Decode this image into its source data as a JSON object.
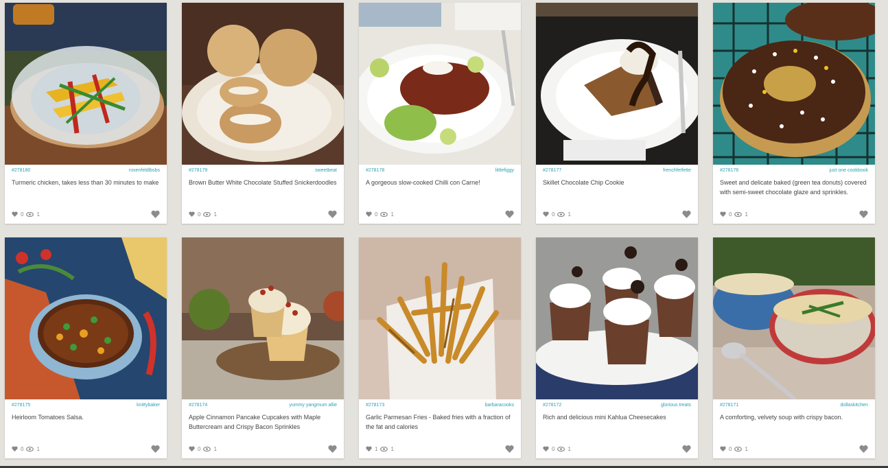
{
  "colors": {
    "background": "#e3e2dd",
    "link": "#2b9fb5",
    "text": "#444444",
    "icon": "#888888"
  },
  "cards": [
    {
      "id": "#278180",
      "user": "rosenfeldlbsbs",
      "desc": "Turmeric chicken, takes less than 30 minutes to make",
      "likes": "0",
      "views": "1",
      "photo": "turmeric-chicken"
    },
    {
      "id": "#278179",
      "user": "sweetbeat",
      "desc": "Brown Butter White Chocolate Stuffed Snickerdoodles",
      "likes": "0",
      "views": "1",
      "photo": "snickerdoodles"
    },
    {
      "id": "#278178",
      "user": "littlefiggy",
      "desc": "A gorgeous slow-cooked Chilli con Carne!",
      "likes": "0",
      "views": "1",
      "photo": "chilli"
    },
    {
      "id": "#278177",
      "user": "frenchfetfette",
      "desc": "Skillet Chocolate Chip Cookie",
      "likes": "0",
      "views": "1",
      "photo": "skillet-cookie"
    },
    {
      "id": "#278176",
      "user": "just one cookbook",
      "desc": "Sweet and delicate baked (green tea donuts) covered with semi-sweet chocolate glaze and sprinkles.",
      "likes": "0",
      "views": "1",
      "photo": "donut"
    },
    {
      "id": "#278175",
      "user": "knittybaker",
      "desc": "Heirloom Tomatoes Salsa.",
      "likes": "0",
      "views": "1",
      "photo": "salsa"
    },
    {
      "id": "#278174",
      "user": "yummy yangmum allie",
      "desc": "Apple Cinnamon Pancake Cupcakes with Maple Buttercream and Crispy Bacon Sprinkles",
      "likes": "0",
      "views": "1",
      "photo": "cupcakes"
    },
    {
      "id": "#278173",
      "user": "barbaracooks",
      "desc": "Garlic Parmesan Fries - Baked fries with a fraction of the fat and calories",
      "likes": "1",
      "views": "1",
      "photo": "fries"
    },
    {
      "id": "#278172",
      "user": "glorious treats",
      "desc": "Rich and delicious mini Kahlua Cheesecakes",
      "likes": "0",
      "views": "1",
      "photo": "cheesecakes"
    },
    {
      "id": "#278171",
      "user": "dollaskitchen",
      "desc": "A comforting, velvety soup with crispy bacon.",
      "likes": "0",
      "views": "1",
      "photo": "soup"
    }
  ]
}
